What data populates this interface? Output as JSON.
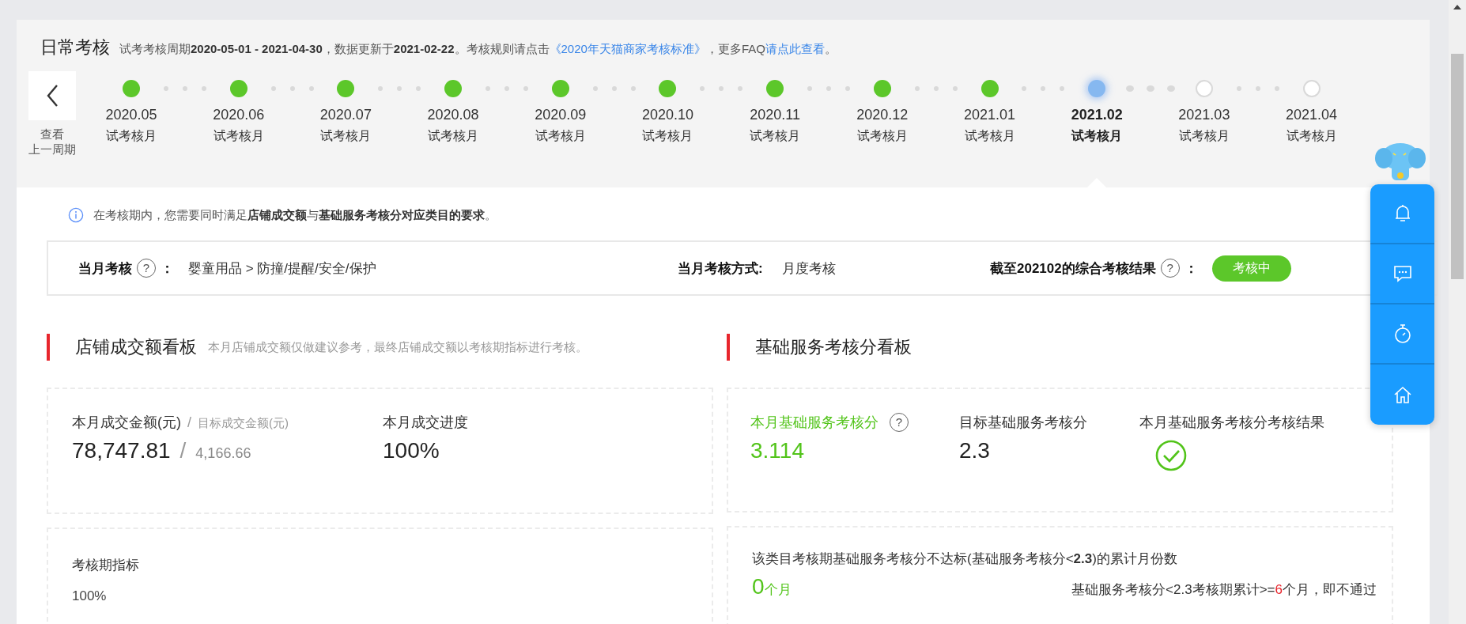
{
  "header": {
    "title": "日常考核",
    "description": "试考考核周期**2020-05-01 - 2021-04-30**，数据更新于**2021-02-22**。考核规则请点击",
    "rule_link": "《2020年天猫商家考核标准》",
    "faq_prefix": "，更多FAQ",
    "faq_link": "请点此查看",
    "faq_suffix": "。"
  },
  "previous_period": {
    "lines": [
      "查看",
      "上一周期"
    ]
  },
  "timeline": [
    {
      "month": "2020.05",
      "label": "试考核月",
      "completed": true,
      "selected": false
    },
    {
      "month": "2020.06",
      "label": "试考核月",
      "completed": true,
      "selected": false
    },
    {
      "month": "2020.07",
      "label": "试考核月",
      "completed": true,
      "selected": false
    },
    {
      "month": "2020.08",
      "label": "试考核月",
      "completed": true,
      "selected": false
    },
    {
      "month": "2020.09",
      "label": "试考核月",
      "completed": true,
      "selected": false
    },
    {
      "month": "2020.10",
      "label": "试考核月",
      "completed": true,
      "selected": false
    },
    {
      "month": "2020.11",
      "label": "试考核月",
      "completed": true,
      "selected": false
    },
    {
      "month": "2020.12",
      "label": "试考核月",
      "completed": true,
      "selected": false
    },
    {
      "month": "2021.01",
      "label": "试考核月",
      "completed": true,
      "selected": false
    },
    {
      "month": "2021.02",
      "label": "试考核月",
      "completed": false,
      "selected": true
    },
    {
      "month": "2021.03",
      "label": "试考核月",
      "completed": false,
      "selected": false
    },
    {
      "month": "2021.04",
      "label": "试考核月",
      "completed": false,
      "selected": false
    }
  ],
  "notice": "在考核期内，您需要同时满足**店铺成交额**与**基础服务考核分对应类目的要求**。",
  "summary": {
    "category_label": "当月考核",
    "category_help": "?",
    "category_colon": "：",
    "category": "婴童用品 > 防撞/提醒/安全/保护",
    "method_label": "当月考核方式:",
    "method": "月度考核",
    "result_label": "截至202102的综合考核结果",
    "result_help": "?",
    "result_colon": "：",
    "result_badge": "考核中"
  },
  "sales_board": {
    "title": "店铺成交额看板",
    "note": "本月店铺成交额仅做建议参考，最终店铺成交额以考核期指标进行考核。",
    "actual_label": "本月成交金额(元)",
    "label_separator": "/",
    "target_label": "目标成交金额(元)",
    "actual_value": "78,747.81",
    "value_separator": "/",
    "target_value": "4,166.66",
    "progress_label": "本月成交进度",
    "progress_value": "100%",
    "period_label": "考核期指标",
    "period_value": "100%"
  },
  "service_board": {
    "title": "基础服务考核分看板",
    "score_label": "本月基础服务考核分",
    "score_help": "?",
    "score_value": "3.114",
    "target_label": "目标基础服务考核分",
    "target_value": "2.3",
    "result_label": "本月基础服务考核分考核结果",
    "passed": true,
    "fail_months_label": "该类目考核期基础服务考核分不达标(基础服务考核分<**2.3**)的累计月份数",
    "fail_months_value": "0",
    "fail_months_unit": "个月",
    "rule_before": "基础服务考核分<2.3考核期累计>=",
    "rule_count": "6",
    "rule_after": "个月，即不通过"
  }
}
